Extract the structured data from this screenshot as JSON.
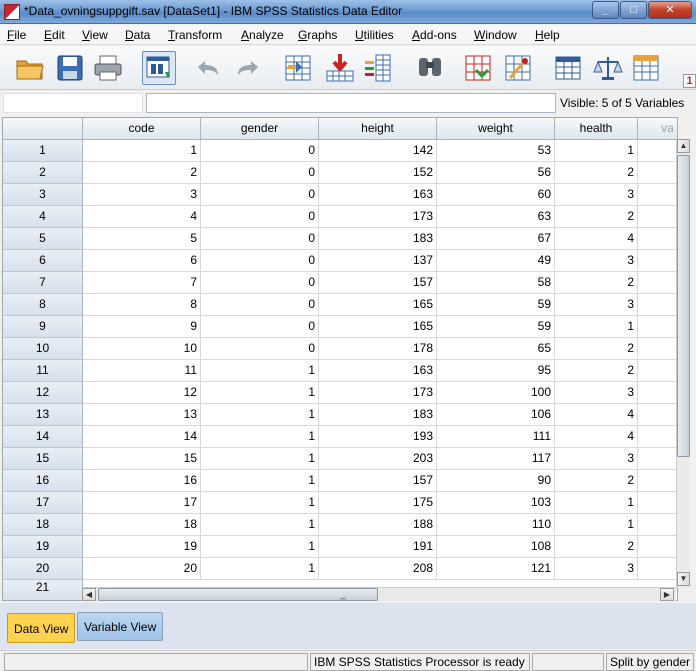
{
  "window": {
    "title": "*Data_ovningsuppgift.sav [DataSet1] - IBM SPSS Statistics Data Editor"
  },
  "menu": [
    "File",
    "Edit",
    "View",
    "Data",
    "Transform",
    "Analyze",
    "Graphs",
    "Utilities",
    "Add-ons",
    "Window",
    "Help"
  ],
  "toolbar": {
    "icons": [
      "open-folder-icon",
      "save-icon",
      "print-icon",
      "recall-dialog-icon",
      "undo-icon",
      "redo-icon",
      "goto-case-icon",
      "goto-variable-icon",
      "variables-icon",
      "find-icon",
      "insert-cases-icon",
      "insert-variable-icon",
      "split-file-icon",
      "weight-cases-icon",
      "select-cases-icon"
    ],
    "overflow_label": "1"
  },
  "cell_editor": {
    "reference": "",
    "value": "",
    "visible_variables": "Visible: 5 of 5 Variables"
  },
  "grid": {
    "columns": [
      "code",
      "gender",
      "height",
      "weight",
      "health",
      "va"
    ],
    "rows": [
      {
        "n": "1",
        "code": "1",
        "gender": "0",
        "height": "142",
        "weight": "53",
        "health": "1"
      },
      {
        "n": "2",
        "code": "2",
        "gender": "0",
        "height": "152",
        "weight": "56",
        "health": "2"
      },
      {
        "n": "3",
        "code": "3",
        "gender": "0",
        "height": "163",
        "weight": "60",
        "health": "3"
      },
      {
        "n": "4",
        "code": "4",
        "gender": "0",
        "height": "173",
        "weight": "63",
        "health": "2"
      },
      {
        "n": "5",
        "code": "5",
        "gender": "0",
        "height": "183",
        "weight": "67",
        "health": "4"
      },
      {
        "n": "6",
        "code": "6",
        "gender": "0",
        "height": "137",
        "weight": "49",
        "health": "3"
      },
      {
        "n": "7",
        "code": "7",
        "gender": "0",
        "height": "157",
        "weight": "58",
        "health": "2"
      },
      {
        "n": "8",
        "code": "8",
        "gender": "0",
        "height": "165",
        "weight": "59",
        "health": "3"
      },
      {
        "n": "9",
        "code": "9",
        "gender": "0",
        "height": "165",
        "weight": "59",
        "health": "1"
      },
      {
        "n": "10",
        "code": "10",
        "gender": "0",
        "height": "178",
        "weight": "65",
        "health": "2"
      },
      {
        "n": "11",
        "code": "11",
        "gender": "1",
        "height": "163",
        "weight": "95",
        "health": "2"
      },
      {
        "n": "12",
        "code": "12",
        "gender": "1",
        "height": "173",
        "weight": "100",
        "health": "3"
      },
      {
        "n": "13",
        "code": "13",
        "gender": "1",
        "height": "183",
        "weight": "106",
        "health": "4"
      },
      {
        "n": "14",
        "code": "14",
        "gender": "1",
        "height": "193",
        "weight": "111",
        "health": "4"
      },
      {
        "n": "15",
        "code": "15",
        "gender": "1",
        "height": "203",
        "weight": "117",
        "health": "3"
      },
      {
        "n": "16",
        "code": "16",
        "gender": "1",
        "height": "157",
        "weight": "90",
        "health": "2"
      },
      {
        "n": "17",
        "code": "17",
        "gender": "1",
        "height": "175",
        "weight": "103",
        "health": "1"
      },
      {
        "n": "18",
        "code": "18",
        "gender": "1",
        "height": "188",
        "weight": "110",
        "health": "1"
      },
      {
        "n": "19",
        "code": "19",
        "gender": "1",
        "height": "191",
        "weight": "108",
        "health": "2"
      },
      {
        "n": "20",
        "code": "20",
        "gender": "1",
        "height": "208",
        "weight": "121",
        "health": "3"
      }
    ],
    "partial_row": "21"
  },
  "tabs": {
    "data_view": "Data View",
    "variable_view": "Variable View",
    "active": "Data View"
  },
  "status": {
    "processor": "IBM SPSS Statistics Processor is ready",
    "split": "Split by gender"
  },
  "colors": {
    "active_tab": "#ffd34e",
    "inactive_tab": "#9dc3e8",
    "title_bar": "#6b9bd0"
  }
}
